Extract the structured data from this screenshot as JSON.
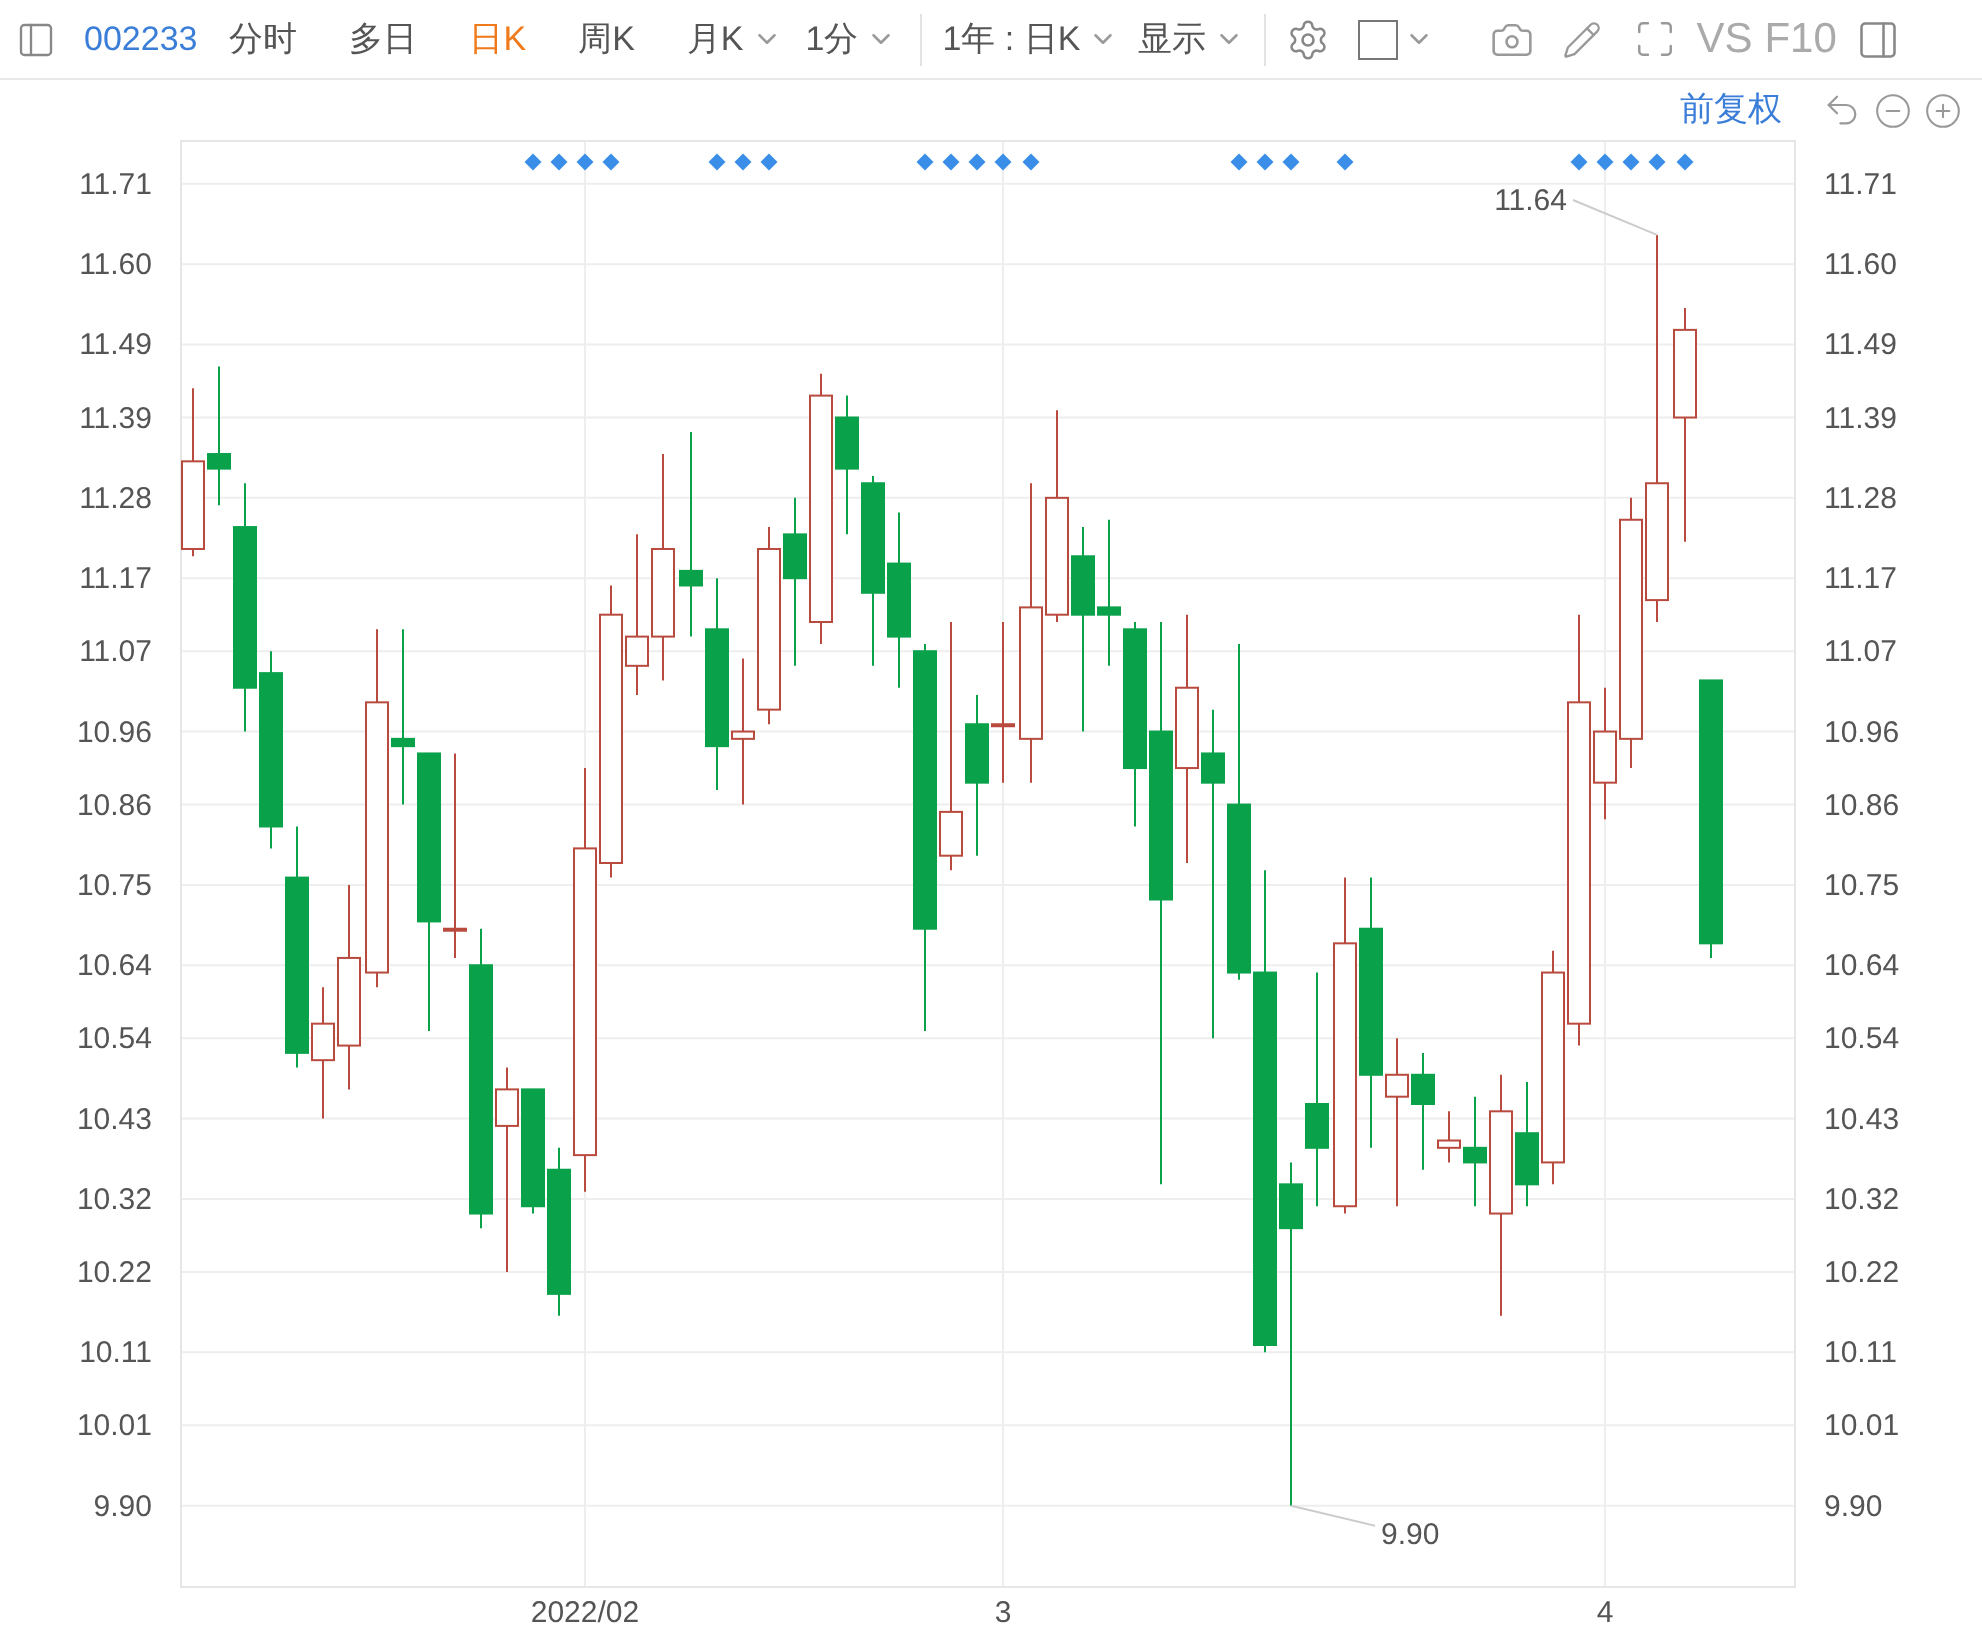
{
  "toolbar": {
    "stock_code": "002233",
    "period_tabs": [
      {
        "label": "分时",
        "selected": false
      },
      {
        "label": "多日",
        "selected": false
      },
      {
        "label": "日K",
        "selected": true
      },
      {
        "label": "周K",
        "selected": false
      }
    ],
    "dropdowns": [
      {
        "label": "月K"
      },
      {
        "label": "1分"
      }
    ],
    "range_dropdowns": [
      {
        "label": "1年 : 日K"
      },
      {
        "label": "显示"
      }
    ],
    "overlay_checkbox": {
      "checked": false
    },
    "compare_label": "VS",
    "f10_label": "F10"
  },
  "adjust_bar": {
    "label": "前复权"
  },
  "chart": {
    "chart_data": {
      "type": "candlestick",
      "ylim": [
        9.79,
        11.77
      ],
      "yticks": [
        {
          "value": 11.71,
          "label": "11.71"
        },
        {
          "value": 11.6,
          "label": "11.60"
        },
        {
          "value": 11.49,
          "label": "11.49"
        },
        {
          "value": 11.39,
          "label": "11.39"
        },
        {
          "value": 11.28,
          "label": "11.28"
        },
        {
          "value": 11.17,
          "label": "11.17"
        },
        {
          "value": 11.07,
          "label": "11.07"
        },
        {
          "value": 10.96,
          "label": "10.96"
        },
        {
          "value": 10.86,
          "label": "10.86"
        },
        {
          "value": 10.75,
          "label": "10.75"
        },
        {
          "value": 10.64,
          "label": "10.64"
        },
        {
          "value": 10.54,
          "label": "10.54"
        },
        {
          "value": 10.43,
          "label": "10.43"
        },
        {
          "value": 10.32,
          "label": "10.32"
        },
        {
          "value": 10.22,
          "label": "10.22"
        },
        {
          "value": 10.11,
          "label": "10.11"
        },
        {
          "value": 10.01,
          "label": "10.01"
        },
        {
          "value": 9.9,
          "label": "9.90"
        }
      ],
      "categories": [
        null,
        null,
        null,
        null,
        null,
        null,
        null,
        null,
        null,
        null,
        null,
        null,
        null,
        null,
        null,
        "2022/02",
        null,
        null,
        null,
        null,
        null,
        null,
        null,
        null,
        null,
        null,
        null,
        null,
        null,
        null,
        null,
        "3",
        null,
        null,
        null,
        null,
        null,
        null,
        null,
        null,
        null,
        null,
        null,
        null,
        null,
        null,
        null,
        null,
        null,
        null,
        null,
        null,
        null,
        null,
        "4",
        null,
        null,
        null,
        null
      ],
      "ohlc": [
        [
          11.21,
          11.43,
          11.2,
          11.33
        ],
        [
          11.34,
          11.46,
          11.27,
          11.32
        ],
        [
          11.24,
          11.3,
          10.96,
          11.02
        ],
        [
          11.04,
          11.07,
          10.8,
          10.83
        ],
        [
          10.76,
          10.83,
          10.5,
          10.52
        ],
        [
          10.51,
          10.61,
          10.43,
          10.56
        ],
        [
          10.53,
          10.75,
          10.47,
          10.65
        ],
        [
          10.63,
          11.1,
          10.61,
          11.0
        ],
        [
          10.95,
          11.1,
          10.86,
          10.94
        ],
        [
          10.93,
          10.93,
          10.55,
          10.7
        ],
        [
          10.69,
          10.93,
          10.65,
          10.69
        ],
        [
          10.64,
          10.69,
          10.28,
          10.3
        ],
        [
          10.42,
          10.5,
          10.22,
          10.47
        ],
        [
          10.47,
          10.47,
          10.3,
          10.31
        ],
        [
          10.36,
          10.39,
          10.16,
          10.19
        ],
        [
          10.38,
          10.91,
          10.33,
          10.8
        ],
        [
          10.78,
          11.16,
          10.76,
          11.12
        ],
        [
          11.05,
          11.23,
          11.01,
          11.09
        ],
        [
          11.09,
          11.34,
          11.03,
          11.21
        ],
        [
          11.18,
          11.37,
          11.09,
          11.16
        ],
        [
          11.1,
          11.17,
          10.88,
          10.94
        ],
        [
          10.95,
          11.06,
          10.86,
          10.96
        ],
        [
          10.99,
          11.24,
          10.97,
          11.21
        ],
        [
          11.23,
          11.28,
          11.05,
          11.17
        ],
        [
          11.11,
          11.45,
          11.08,
          11.42
        ],
        [
          11.39,
          11.42,
          11.23,
          11.32
        ],
        [
          11.3,
          11.31,
          11.05,
          11.15
        ],
        [
          11.19,
          11.26,
          11.02,
          11.09
        ],
        [
          11.07,
          11.08,
          10.55,
          10.69
        ],
        [
          10.79,
          11.11,
          10.77,
          10.85
        ],
        [
          10.97,
          11.01,
          10.79,
          10.89
        ],
        [
          10.97,
          11.11,
          10.89,
          10.97
        ],
        [
          10.95,
          11.3,
          10.89,
          11.13
        ],
        [
          11.12,
          11.4,
          11.11,
          11.28
        ],
        [
          11.2,
          11.24,
          10.96,
          11.12
        ],
        [
          11.13,
          11.25,
          11.05,
          11.12
        ],
        [
          11.1,
          11.11,
          10.83,
          10.91
        ],
        [
          10.96,
          11.11,
          10.34,
          10.73
        ],
        [
          10.91,
          11.12,
          10.78,
          11.02
        ],
        [
          10.93,
          10.99,
          10.54,
          10.89
        ],
        [
          10.86,
          11.08,
          10.62,
          10.63
        ],
        [
          10.63,
          10.77,
          10.11,
          10.12
        ],
        [
          10.34,
          10.37,
          9.9,
          10.28
        ],
        [
          10.45,
          10.63,
          10.31,
          10.39
        ],
        [
          10.31,
          10.76,
          10.3,
          10.67
        ],
        [
          10.69,
          10.76,
          10.39,
          10.49
        ],
        [
          10.46,
          10.54,
          10.31,
          10.49
        ],
        [
          10.49,
          10.52,
          10.36,
          10.45
        ],
        [
          10.39,
          10.44,
          10.37,
          10.4
        ],
        [
          10.39,
          10.46,
          10.31,
          10.37
        ],
        [
          10.3,
          10.49,
          10.16,
          10.44
        ],
        [
          10.41,
          10.48,
          10.31,
          10.34
        ],
        [
          10.37,
          10.66,
          10.34,
          10.63
        ],
        [
          10.56,
          11.12,
          10.53,
          11.0
        ],
        [
          10.89,
          11.02,
          10.84,
          10.96
        ],
        [
          10.95,
          11.28,
          10.91,
          11.25
        ],
        [
          11.14,
          11.64,
          11.11,
          11.3
        ],
        [
          11.39,
          11.54,
          11.22,
          11.51
        ],
        [
          11.03,
          11.03,
          10.65,
          10.67
        ]
      ],
      "grid": true,
      "annotations": [
        "11.64",
        "9.90"
      ]
    },
    "event_markers": [
      {
        "shown": false
      },
      {
        "shown": false
      },
      {
        "shown": false
      },
      {
        "shown": false
      },
      {
        "shown": false
      },
      {
        "shown": false
      },
      {
        "shown": false
      },
      {
        "shown": false
      },
      {
        "shown": false
      },
      {
        "shown": false
      },
      {
        "shown": false
      },
      {
        "shown": false
      },
      {
        "shown": false
      },
      {
        "shown": true
      },
      {
        "shown": true
      },
      {
        "shown": true
      },
      {
        "shown": true
      },
      {
        "shown": false
      },
      {
        "shown": false
      },
      {
        "shown": false
      },
      {
        "shown": true
      },
      {
        "shown": true
      },
      {
        "shown": true
      },
      {
        "shown": false
      },
      {
        "shown": false
      },
      {
        "shown": false
      },
      {
        "shown": false
      },
      {
        "shown": false
      },
      {
        "shown": true
      },
      {
        "shown": true
      },
      {
        "shown": true
      },
      {
        "shown": true
      },
      {
        "shown": true
      },
      {
        "shown": false
      },
      {
        "shown": false
      },
      {
        "shown": false
      },
      {
        "shown": false
      },
      {
        "shown": false
      },
      {
        "shown": false
      },
      {
        "shown": false
      },
      {
        "shown": true
      },
      {
        "shown": true
      },
      {
        "shown": true
      },
      {
        "shown": false
      },
      {
        "shown": true
      },
      {
        "shown": false
      },
      {
        "shown": false
      },
      {
        "shown": false
      },
      {
        "shown": false
      },
      {
        "shown": false
      },
      {
        "shown": false
      },
      {
        "shown": false
      },
      {
        "shown": false
      },
      {
        "shown": true
      },
      {
        "shown": true
      },
      {
        "shown": true
      },
      {
        "shown": true
      },
      {
        "shown": true
      },
      {
        "shown": false
      }
    ],
    "right_axis_labels": [
      "11.71",
      "11.60",
      "11.49",
      "11.39",
      "11.28",
      "11.17",
      "11.07",
      "10.96",
      "10.86",
      "10.75",
      "10.64",
      "10.54",
      "10.43",
      "10.32",
      "10.22",
      "10.11",
      "10.01",
      "9.90"
    ]
  }
}
